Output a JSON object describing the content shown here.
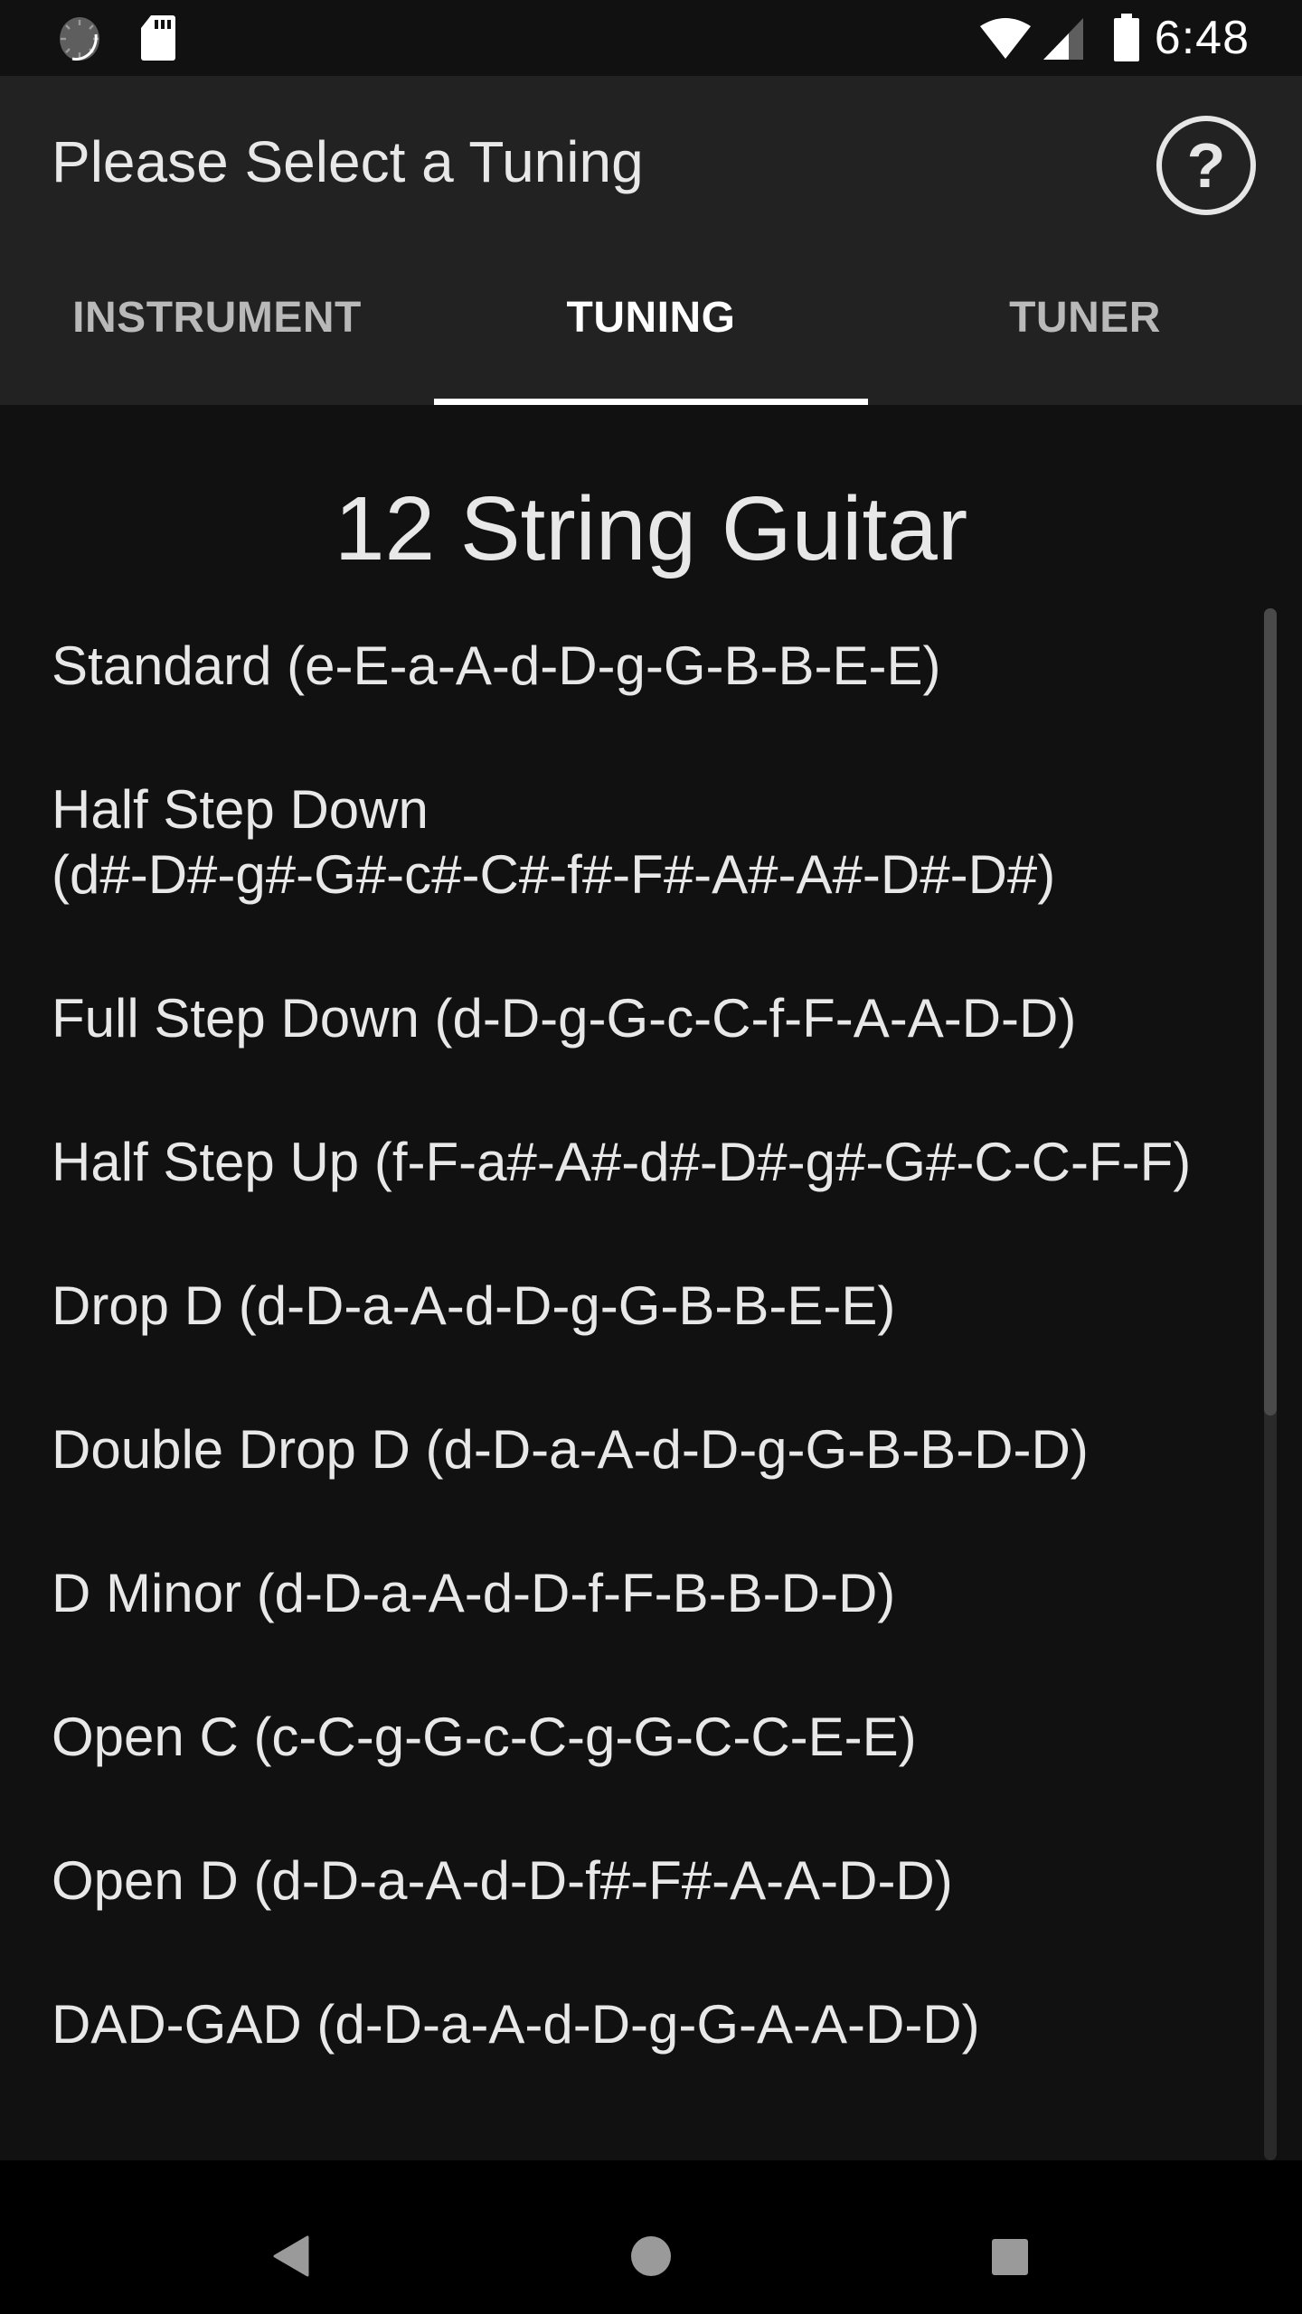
{
  "status_bar": {
    "time": "6:48",
    "left_icons": [
      "sync-icon",
      "sd-card-icon"
    ],
    "right_icons": [
      "wifi-icon",
      "cell-signal-icon",
      "battery-icon"
    ]
  },
  "app_bar": {
    "title": "Please Select a Tuning",
    "help_icon": "help-circle-icon"
  },
  "tabs": [
    {
      "label": "INSTRUMENT",
      "active": false
    },
    {
      "label": "TUNING",
      "active": true
    },
    {
      "label": "TUNER",
      "active": false
    }
  ],
  "content": {
    "instrument_name": "12 String Guitar",
    "tunings": [
      {
        "name": "Standard",
        "notes": "(e-E-a-A-d-D-g-G-B-B-E-E)",
        "label": "Standard (e-E-a-A-d-D-g-G-B-B-E-E)"
      },
      {
        "name": "Half Step Down",
        "notes": "(d#-D#-g#-G#-c#-C#-f#-F#-A#-A#-D#-D#)",
        "label": "Half Step Down (d#-D#-g#-G#-c#-C#-f#-F#-A#-A#-D#-D#)"
      },
      {
        "name": "Full Step Down",
        "notes": "(d-D-g-G-c-C-f-F-A-A-D-D)",
        "label": "Full Step Down (d-D-g-G-c-C-f-F-A-A-D-D)"
      },
      {
        "name": "Half Step Up",
        "notes": "(f-F-a#-A#-d#-D#-g#-G#-C-C-F-F)",
        "label": "Half Step Up (f-F-a#-A#-d#-D#-g#-G#-C-C-F-F)"
      },
      {
        "name": "Drop D",
        "notes": "(d-D-a-A-d-D-g-G-B-B-E-E)",
        "label": "Drop D (d-D-a-A-d-D-g-G-B-B-E-E)"
      },
      {
        "name": "Double Drop D",
        "notes": "(d-D-a-A-d-D-g-G-B-B-D-D)",
        "label": "Double Drop D (d-D-a-A-d-D-g-G-B-B-D-D)"
      },
      {
        "name": "D Minor",
        "notes": "(d-D-a-A-d-D-f-F-B-B-D-D)",
        "label": "D Minor (d-D-a-A-d-D-f-F-B-B-D-D)"
      },
      {
        "name": "Open C",
        "notes": "(c-C-g-G-c-C-g-G-C-C-E-E)",
        "label": "Open C (c-C-g-G-c-C-g-G-C-C-E-E)"
      },
      {
        "name": "Open D",
        "notes": "(d-D-a-A-d-D-f#-F#-A-A-D-D)",
        "label": "Open D (d-D-a-A-d-D-f#-F#-A-A-D-D)"
      },
      {
        "name": "DAD-GAD",
        "notes": "(d-D-a-A-d-D-g-G-A-A-D-D)",
        "label": "DAD-GAD (d-D-a-A-d-D-g-G-A-A-D-D)"
      }
    ]
  },
  "scrollbar": {
    "thumb_fraction": 0.52,
    "scroll_position": 0.0
  },
  "nav_bar": {
    "buttons": [
      "back-icon",
      "home-icon",
      "recents-icon"
    ]
  },
  "colors": {
    "status_bar_bg": "#111111",
    "app_bar_bg": "#222222",
    "content_bg": "#111111",
    "text": "#e8e8e8",
    "tab_inactive": "#b9b9b9",
    "tab_active": "#ffffff",
    "indicator": "#ffffff",
    "nav_bar_bg": "#000000",
    "nav_icon": "#9a9a9a"
  }
}
